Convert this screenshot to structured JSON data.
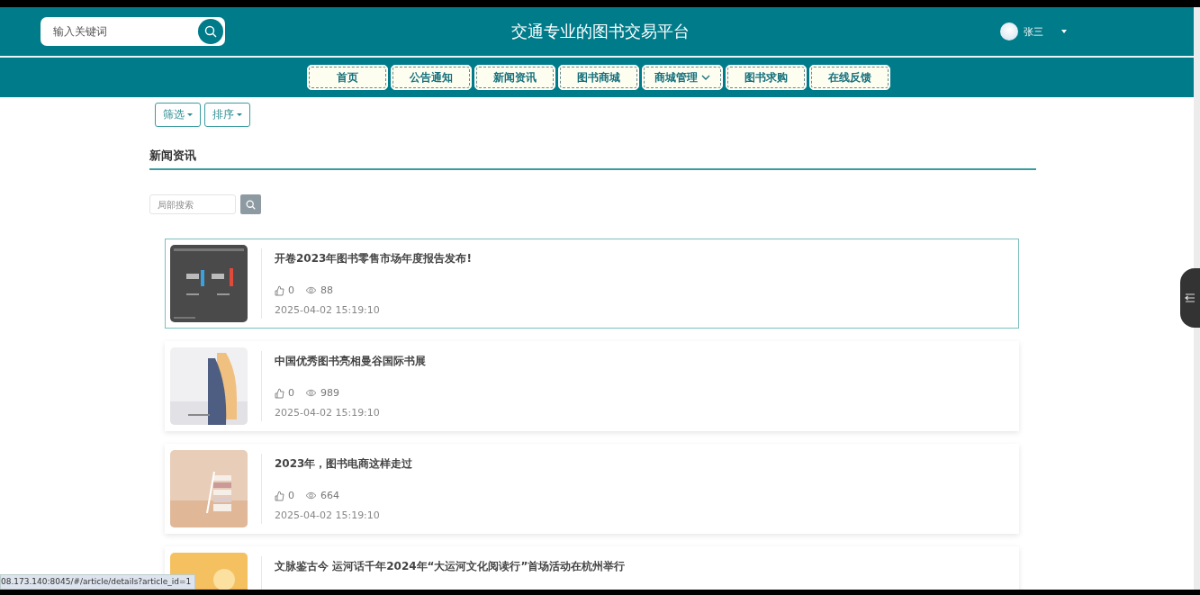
{
  "header": {
    "search": {
      "placeholder": "输入关键词"
    },
    "title": "交通专业的图书交易平台",
    "user": {
      "name": "张三"
    }
  },
  "nav": [
    {
      "label": "首页",
      "dropdown": false
    },
    {
      "label": "公告通知",
      "dropdown": false
    },
    {
      "label": "新闻资讯",
      "dropdown": false
    },
    {
      "label": "图书商城",
      "dropdown": false
    },
    {
      "label": "商城管理",
      "dropdown": true
    },
    {
      "label": "图书求购",
      "dropdown": false
    },
    {
      "label": "在线反馈",
      "dropdown": false
    }
  ],
  "filters": [
    {
      "label": "筛选"
    },
    {
      "label": "排序"
    }
  ],
  "section_title": "新闻资讯",
  "local_search": {
    "placeholder": "局部搜索"
  },
  "articles": [
    {
      "title": "开卷**2023**年图书零售市场年度报告发布!",
      "likes": "0",
      "views": "88",
      "date": "2025-04-02 15:19:10",
      "selected": true
    },
    {
      "title": "中国优秀图书亮相曼谷国际书展",
      "likes": "0",
      "views": "989",
      "date": "2025-04-02 15:19:10",
      "selected": false
    },
    {
      "title": "**2023**年，图书电商这样走过",
      "likes": "0",
      "views": "664",
      "date": "2025-04-02 15:19:10",
      "selected": false
    },
    {
      "title": "文脉鉴古今 运河话千年**2024**年“大运河文化阅读行”首场活动在杭州举行",
      "selected": false
    }
  ],
  "status_bar": {
    "url": "08.173.140:8045/#/article/details?article_id=1"
  }
}
